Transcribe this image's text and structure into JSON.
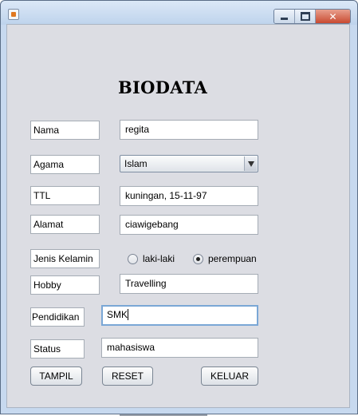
{
  "window": {
    "icons": {
      "app": "java-app-icon",
      "minimize": "minimize-icon",
      "maximize": "maximize-icon",
      "close": "close-icon"
    }
  },
  "form": {
    "heading": "BIODATA",
    "nama": {
      "label": "Nama",
      "value": "regita"
    },
    "agama": {
      "label": "Agama",
      "selected": "Islam"
    },
    "ttl": {
      "label": "TTL",
      "value": "kuningan, 15-11-97"
    },
    "alamat": {
      "label": "Alamat",
      "value": "ciawigebang"
    },
    "jenis_kelamin": {
      "label": "Jenis Kelamin",
      "options": [
        {
          "label": "laki-laki",
          "selected": false
        },
        {
          "label": "perempuan",
          "selected": true
        }
      ]
    },
    "hobby": {
      "label": "Hobby",
      "value": "Travelling"
    },
    "pendidikan": {
      "label": "Pendidikan",
      "value": "SMK"
    },
    "status": {
      "label": "Status",
      "value": "mahasiswa"
    }
  },
  "buttons": {
    "tampil": "TAMPIL",
    "reset": "RESET",
    "keluar": "KELUAR"
  }
}
